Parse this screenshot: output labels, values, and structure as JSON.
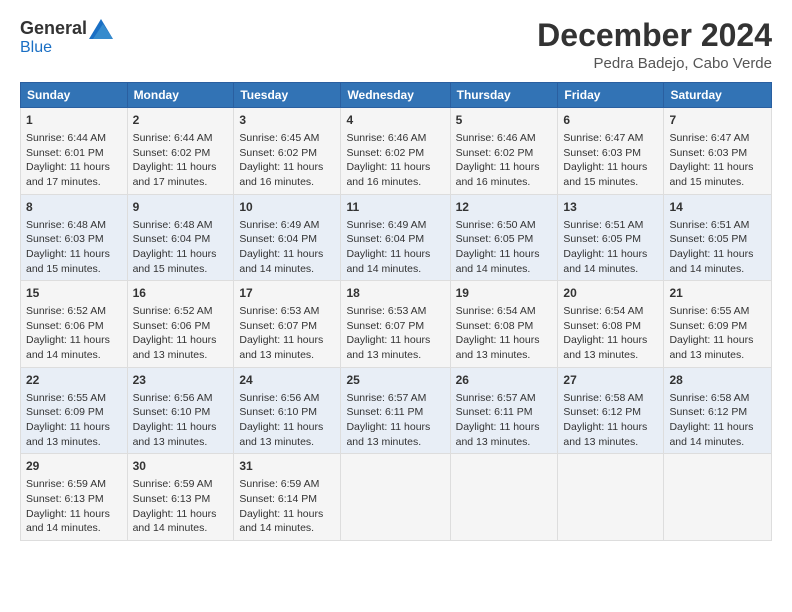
{
  "logo": {
    "general": "General",
    "blue": "Blue"
  },
  "title": "December 2024",
  "location": "Pedra Badejo, Cabo Verde",
  "days_of_week": [
    "Sunday",
    "Monday",
    "Tuesday",
    "Wednesday",
    "Thursday",
    "Friday",
    "Saturday"
  ],
  "weeks": [
    [
      {
        "day": "1",
        "info": "Sunrise: 6:44 AM\nSunset: 6:01 PM\nDaylight: 11 hours\nand 17 minutes."
      },
      {
        "day": "2",
        "info": "Sunrise: 6:44 AM\nSunset: 6:02 PM\nDaylight: 11 hours\nand 17 minutes."
      },
      {
        "day": "3",
        "info": "Sunrise: 6:45 AM\nSunset: 6:02 PM\nDaylight: 11 hours\nand 16 minutes."
      },
      {
        "day": "4",
        "info": "Sunrise: 6:46 AM\nSunset: 6:02 PM\nDaylight: 11 hours\nand 16 minutes."
      },
      {
        "day": "5",
        "info": "Sunrise: 6:46 AM\nSunset: 6:02 PM\nDaylight: 11 hours\nand 16 minutes."
      },
      {
        "day": "6",
        "info": "Sunrise: 6:47 AM\nSunset: 6:03 PM\nDaylight: 11 hours\nand 15 minutes."
      },
      {
        "day": "7",
        "info": "Sunrise: 6:47 AM\nSunset: 6:03 PM\nDaylight: 11 hours\nand 15 minutes."
      }
    ],
    [
      {
        "day": "8",
        "info": "Sunrise: 6:48 AM\nSunset: 6:03 PM\nDaylight: 11 hours\nand 15 minutes."
      },
      {
        "day": "9",
        "info": "Sunrise: 6:48 AM\nSunset: 6:04 PM\nDaylight: 11 hours\nand 15 minutes."
      },
      {
        "day": "10",
        "info": "Sunrise: 6:49 AM\nSunset: 6:04 PM\nDaylight: 11 hours\nand 14 minutes."
      },
      {
        "day": "11",
        "info": "Sunrise: 6:49 AM\nSunset: 6:04 PM\nDaylight: 11 hours\nand 14 minutes."
      },
      {
        "day": "12",
        "info": "Sunrise: 6:50 AM\nSunset: 6:05 PM\nDaylight: 11 hours\nand 14 minutes."
      },
      {
        "day": "13",
        "info": "Sunrise: 6:51 AM\nSunset: 6:05 PM\nDaylight: 11 hours\nand 14 minutes."
      },
      {
        "day": "14",
        "info": "Sunrise: 6:51 AM\nSunset: 6:05 PM\nDaylight: 11 hours\nand 14 minutes."
      }
    ],
    [
      {
        "day": "15",
        "info": "Sunrise: 6:52 AM\nSunset: 6:06 PM\nDaylight: 11 hours\nand 14 minutes."
      },
      {
        "day": "16",
        "info": "Sunrise: 6:52 AM\nSunset: 6:06 PM\nDaylight: 11 hours\nand 13 minutes."
      },
      {
        "day": "17",
        "info": "Sunrise: 6:53 AM\nSunset: 6:07 PM\nDaylight: 11 hours\nand 13 minutes."
      },
      {
        "day": "18",
        "info": "Sunrise: 6:53 AM\nSunset: 6:07 PM\nDaylight: 11 hours\nand 13 minutes."
      },
      {
        "day": "19",
        "info": "Sunrise: 6:54 AM\nSunset: 6:08 PM\nDaylight: 11 hours\nand 13 minutes."
      },
      {
        "day": "20",
        "info": "Sunrise: 6:54 AM\nSunset: 6:08 PM\nDaylight: 11 hours\nand 13 minutes."
      },
      {
        "day": "21",
        "info": "Sunrise: 6:55 AM\nSunset: 6:09 PM\nDaylight: 11 hours\nand 13 minutes."
      }
    ],
    [
      {
        "day": "22",
        "info": "Sunrise: 6:55 AM\nSunset: 6:09 PM\nDaylight: 11 hours\nand 13 minutes."
      },
      {
        "day": "23",
        "info": "Sunrise: 6:56 AM\nSunset: 6:10 PM\nDaylight: 11 hours\nand 13 minutes."
      },
      {
        "day": "24",
        "info": "Sunrise: 6:56 AM\nSunset: 6:10 PM\nDaylight: 11 hours\nand 13 minutes."
      },
      {
        "day": "25",
        "info": "Sunrise: 6:57 AM\nSunset: 6:11 PM\nDaylight: 11 hours\nand 13 minutes."
      },
      {
        "day": "26",
        "info": "Sunrise: 6:57 AM\nSunset: 6:11 PM\nDaylight: 11 hours\nand 13 minutes."
      },
      {
        "day": "27",
        "info": "Sunrise: 6:58 AM\nSunset: 6:12 PM\nDaylight: 11 hours\nand 13 minutes."
      },
      {
        "day": "28",
        "info": "Sunrise: 6:58 AM\nSunset: 6:12 PM\nDaylight: 11 hours\nand 14 minutes."
      }
    ],
    [
      {
        "day": "29",
        "info": "Sunrise: 6:59 AM\nSunset: 6:13 PM\nDaylight: 11 hours\nand 14 minutes."
      },
      {
        "day": "30",
        "info": "Sunrise: 6:59 AM\nSunset: 6:13 PM\nDaylight: 11 hours\nand 14 minutes."
      },
      {
        "day": "31",
        "info": "Sunrise: 6:59 AM\nSunset: 6:14 PM\nDaylight: 11 hours\nand 14 minutes."
      },
      {
        "day": "",
        "info": ""
      },
      {
        "day": "",
        "info": ""
      },
      {
        "day": "",
        "info": ""
      },
      {
        "day": "",
        "info": ""
      }
    ]
  ]
}
